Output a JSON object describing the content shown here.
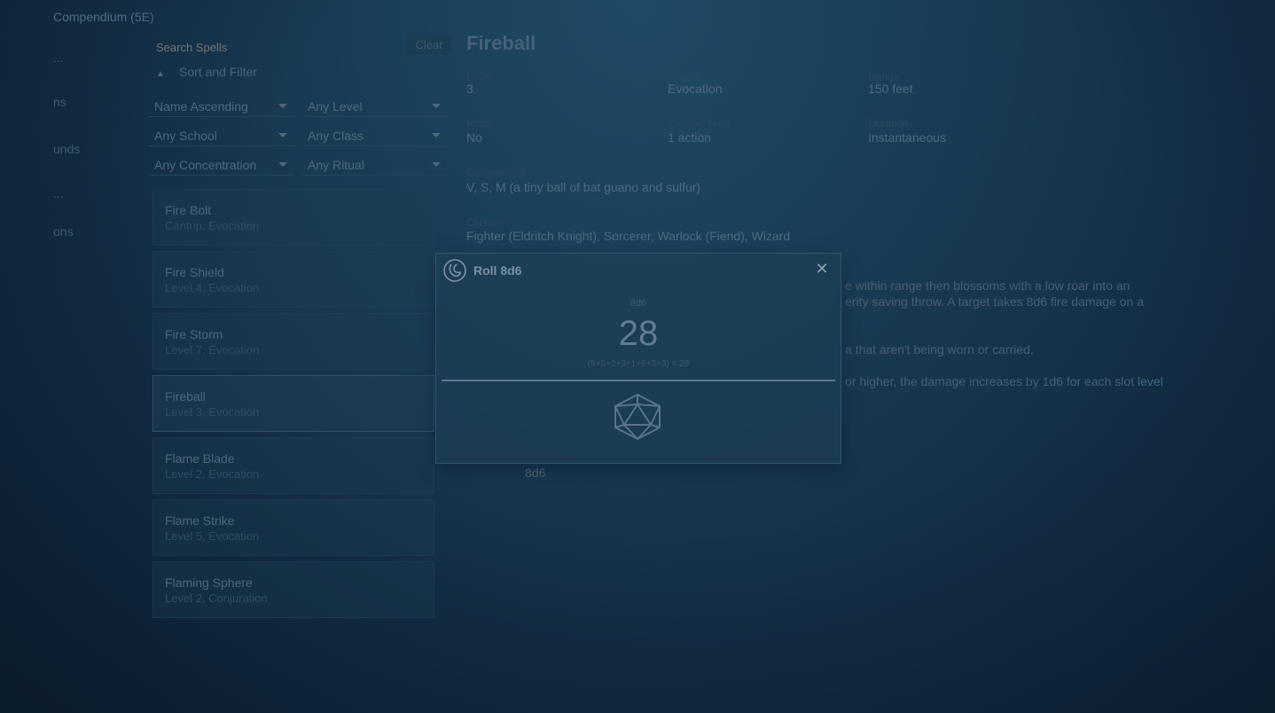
{
  "app": {
    "title": "Compendium (5E)"
  },
  "sidebar": {
    "items": [
      {
        "label": "..."
      },
      {
        "label": "ns"
      },
      {
        "label": "unds"
      },
      {
        "label": "..."
      },
      {
        "label": "ons"
      }
    ]
  },
  "search": {
    "placeholder": "Search Spells",
    "clear_label": "Clear"
  },
  "sort_filter": {
    "label": "Sort and Filter"
  },
  "filters": {
    "sort": "Name Ascending",
    "level": "Any Level",
    "school": "Any School",
    "class": "Any Class",
    "concentration": "Any Concentration",
    "ritual": "Any Ritual"
  },
  "spells": [
    {
      "name": "Fire Bolt",
      "sub": "Cantrip, Evocation"
    },
    {
      "name": "Fire Shield",
      "sub": "Level 4, Evocation"
    },
    {
      "name": "Fire Storm",
      "sub": "Level 7, Evocation"
    },
    {
      "name": "Fireball",
      "sub": "Level 3, Evocation"
    },
    {
      "name": "Flame Blade",
      "sub": "Level 2, Evocation"
    },
    {
      "name": "Flame Strike",
      "sub": "Level 5, Evocation"
    },
    {
      "name": "Flaming Sphere",
      "sub": "Level 2, Conjuration"
    }
  ],
  "detail": {
    "title": "Fireball",
    "level_label": "Level",
    "level": "3",
    "school_label": "School",
    "school": "Evocation",
    "range_label": "Range",
    "range": "150 feet",
    "ritual_label": "Ritual",
    "ritual": "No",
    "casting_label": "Casting Time",
    "casting": "1 action",
    "duration_label": "Duration",
    "duration": "Instantaneous",
    "components_label": "Components",
    "components": "V, S, M (a tiny ball of bat guano and sulfur)",
    "classes_label": "Classes",
    "classes": "Fighter (Eldritch Knight), Sorcerer, Warlock (Fiend), Wizard",
    "desc1": "e within range then blossoms with a low roar into an",
    "desc2": "erity saving throw. A target takes 8d6 fire damage on a",
    "desc3": "a that aren't being worn or carried.",
    "desc4a": "or higher, the damage increases by 1d6 for each slot ",
    "desc4b": "level",
    "damage_roll": "8d6"
  },
  "dialog": {
    "title": "Roll 8d6",
    "close": "✕",
    "expression": "8d6",
    "total": "28",
    "breakdown": "(5+5+2+3+1+6+3+3) = 28"
  }
}
